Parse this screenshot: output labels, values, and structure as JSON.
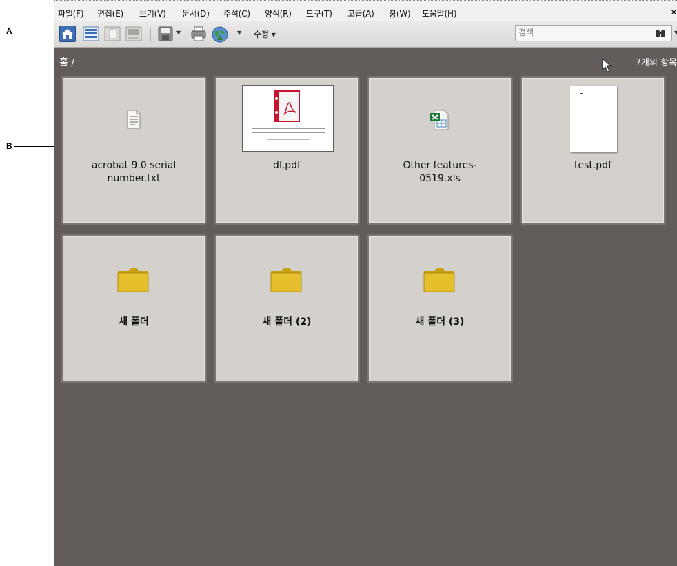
{
  "callouts": {
    "a": "A",
    "b": "B"
  },
  "menu": {
    "items": [
      "파일(F)",
      "편집(E)",
      "보기(V)",
      "문서(D)",
      "주석(C)",
      "양식(R)",
      "도구(T)",
      "고급(A)",
      "창(W)",
      "도움말(H)"
    ],
    "close": "×"
  },
  "toolbar": {
    "edit_label": "수정 ▾",
    "search_placeholder": "검색",
    "icons": [
      "home-icon",
      "list-view-icon",
      "page-view-icon",
      "filmstrip-icon",
      "save-icon",
      "print-icon",
      "globe-icon",
      "binoculars-icon"
    ]
  },
  "breadcrumb": "홈 /",
  "item_count": "7개의 항목",
  "files": [
    {
      "name": "acrobat 9.0 serial\nnumber.txt",
      "type": "txt"
    },
    {
      "name": "df.pdf",
      "type": "pdf-thumb"
    },
    {
      "name": "Other features-\n0519.xls",
      "type": "xls"
    },
    {
      "name": "test.pdf",
      "type": "pdf-blank"
    }
  ],
  "folders": [
    {
      "name": "새 폴더"
    },
    {
      "name": "새 폴더 (2)"
    },
    {
      "name": "새 폴더 (3)"
    }
  ],
  "colors": {
    "background": "#625d5a",
    "tile": "#d4d0cc",
    "home_active": "#3a6fb3"
  }
}
